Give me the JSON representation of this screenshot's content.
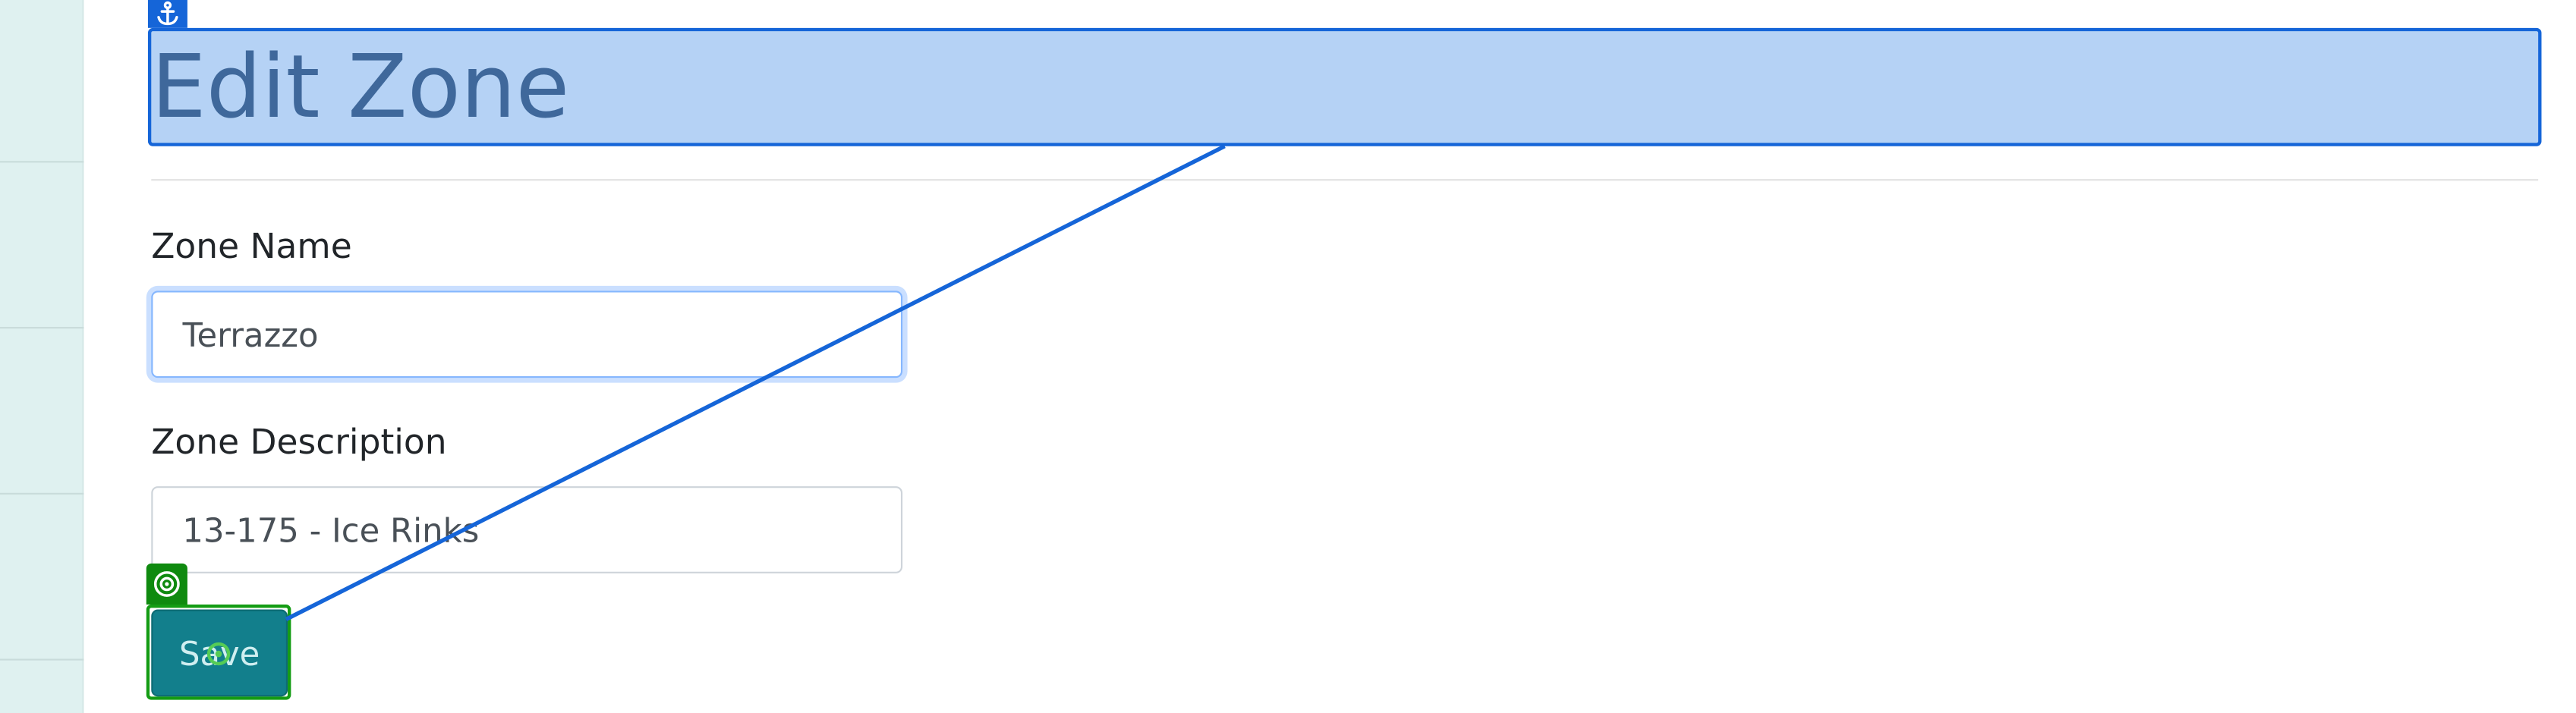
{
  "page": {
    "title": "Edit Zone"
  },
  "form": {
    "zone_name": {
      "label": "Zone Name",
      "value": "Terrazzo"
    },
    "zone_description": {
      "label": "Zone Description",
      "value": "13-175 - Ice Rinks"
    },
    "save_label": "Save"
  },
  "annotations": {
    "anchor_icon": "anchor-icon",
    "target_icon": "target-icon",
    "cursor_icon": "cursor-target-icon",
    "anchor_color": "#1565d8",
    "target_color": "#149c14"
  },
  "colors": {
    "sidebar_bg": "#dff1f0",
    "button_bg": "#127f8c",
    "title_text": "#1d3553"
  }
}
